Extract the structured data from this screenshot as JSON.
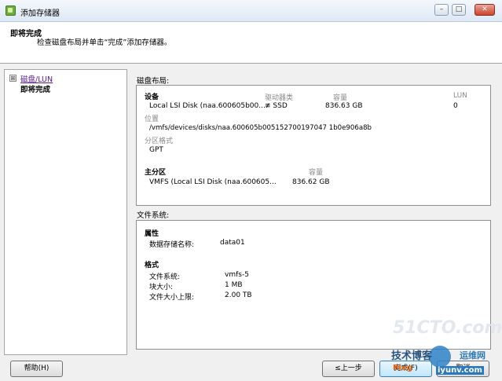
{
  "window": {
    "title": "添加存储器"
  },
  "header": {
    "title": "即将完成",
    "subtitle": "检查磁盘布局并单击“完成”添加存储器。"
  },
  "nav": {
    "expander": "⊞",
    "items": [
      {
        "label": "磁盘/LUN"
      },
      {
        "label": "即将完成"
      }
    ]
  },
  "disk_layout": {
    "section_label": "磁盘布局:",
    "device_header": "设备",
    "drive_type_header": "驱动器类",
    "capacity_header": "容量",
    "lun_header": "LUN",
    "device_name": "Local LSI Disk (naa.600605b00...",
    "drive_type": "SSD",
    "capacity": "836.63 GB",
    "lun": "0",
    "location_label": "位置",
    "location_value": "/vmfs/devices/disks/naa.600605b005152700197047 1b0e906a8b",
    "partition_format_label": "分区格式",
    "partition_format_value": "GPT",
    "primary_partition_header": "主分区",
    "primary_capacity_header": "容量",
    "primary_partition_value": "VMFS (Local LSI Disk (naa.600605...",
    "primary_capacity_value": "836.62 GB"
  },
  "file_system": {
    "section_label": "文件系统:",
    "properties_header": "属性",
    "datastore_name_label": "数据存储名称:",
    "datastore_name_value": "data01",
    "format_header": "格式",
    "fs_label": "文件系统:",
    "fs_value": "vmfs-5",
    "block_size_label": "块大小:",
    "block_size_value": "1 MB",
    "max_file_size_label": "文件大小上限:",
    "max_file_size_value": "2.00 TB"
  },
  "buttons": {
    "help": "帮助(H)",
    "back": "≤上一步",
    "finish": "完成(F)",
    "cancel": "取消"
  },
  "watermark": {
    "site": "51CTO.com",
    "line1": "技术博客",
    "line2": "Blog",
    "line3": "iyunv.com",
    "line4": "运维网"
  }
}
